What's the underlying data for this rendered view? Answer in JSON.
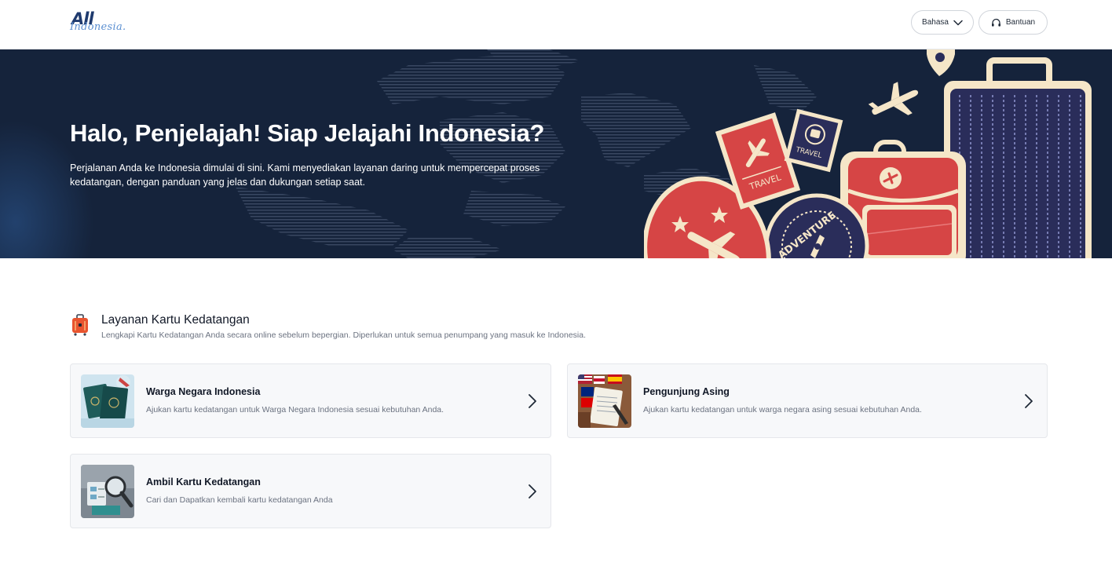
{
  "header": {
    "logo_main": "All",
    "logo_sub": "Indonesia.",
    "language_label": "Bahasa",
    "help_label": "Bantuan"
  },
  "hero": {
    "title": "Halo, Penjelajah! Siap Jelajahi Indonesia?",
    "description": "Perjalanan Anda ke Indonesia dimulai di sini. Kami menyediakan layanan daring untuk mempercepat proses kedatangan, dengan panduan yang jelas dan dukungan setiap saat.",
    "stamp_labels": {
      "travel_1": "TRAVEL",
      "travel_2": "TRAVEL",
      "adventure": "ADVENTURE"
    }
  },
  "section": {
    "icon": "suitcase-icon",
    "title": "Layanan Kartu Kedatangan",
    "subtitle": "Lengkapi Kartu Kedatangan Anda secara online sebelum bepergian. Diperlukan untuk semua penumpang yang masuk ke Indonesia."
  },
  "cards": [
    {
      "title": "Warga Negara Indonesia",
      "description": "Ajukan kartu kedatangan untuk Warga Negara Indonesia sesuai kebutuhan Anda.",
      "icon": "chevron-right-icon"
    },
    {
      "title": "Pengunjung Asing",
      "description": "Ajukan kartu kedatangan untuk warga negara asing sesuai kebutuhan Anda.",
      "icon": "chevron-right-icon"
    },
    {
      "title": "Ambil Kartu Kedatangan",
      "description": "Cari dan Dapatkan kembali kartu kedatangan Anda",
      "icon": "chevron-right-icon"
    }
  ],
  "colors": {
    "hero_bg": "#15233b",
    "accent_red": "#d64545",
    "cream": "#f5e6c8",
    "navy": "#2a2d5a"
  }
}
